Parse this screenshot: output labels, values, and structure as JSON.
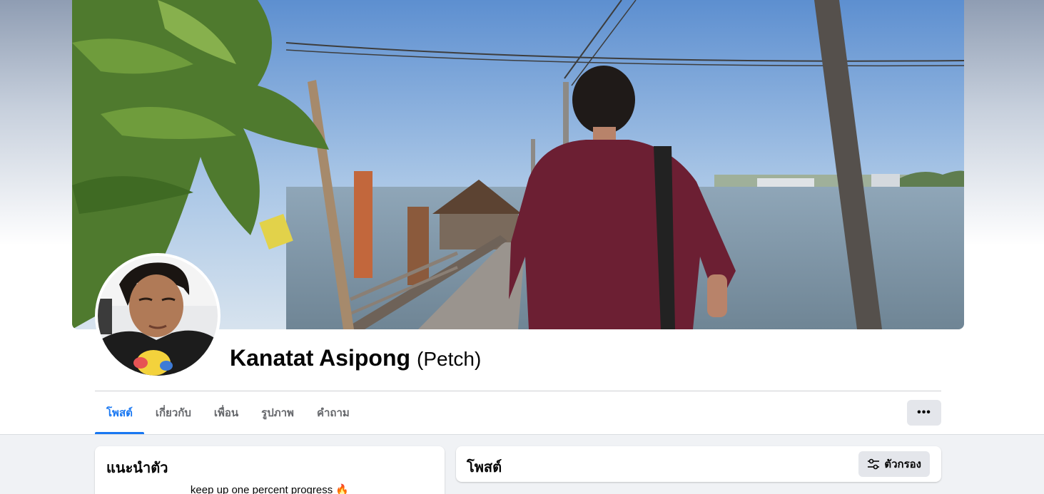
{
  "profile": {
    "name": "Kanatat Asipong",
    "alternate_name": "(Petch)",
    "cover_photo": "cover-photo",
    "profile_picture": "profile-picture"
  },
  "tabs": [
    {
      "label": "โพสต์",
      "active": true
    },
    {
      "label": "เกี่ยวกับ",
      "active": false
    },
    {
      "label": "เพื่อน",
      "active": false
    },
    {
      "label": "รูปภาพ",
      "active": false
    },
    {
      "label": "คำถาม",
      "active": false
    }
  ],
  "more_button": {
    "icon": "more-dots-icon",
    "label": "•••"
  },
  "intro": {
    "title": "แนะนำตัว",
    "bio": "keep up one percent progress 🔥"
  },
  "posts": {
    "title": "โพสต์",
    "filter_label": "ตัวกรอง",
    "filter_icon": "sliders-icon"
  },
  "colors": {
    "accent": "#1877f2",
    "page_bg": "#f0f2f5",
    "button_bg": "#e4e6eb",
    "muted_text": "#65676b"
  }
}
